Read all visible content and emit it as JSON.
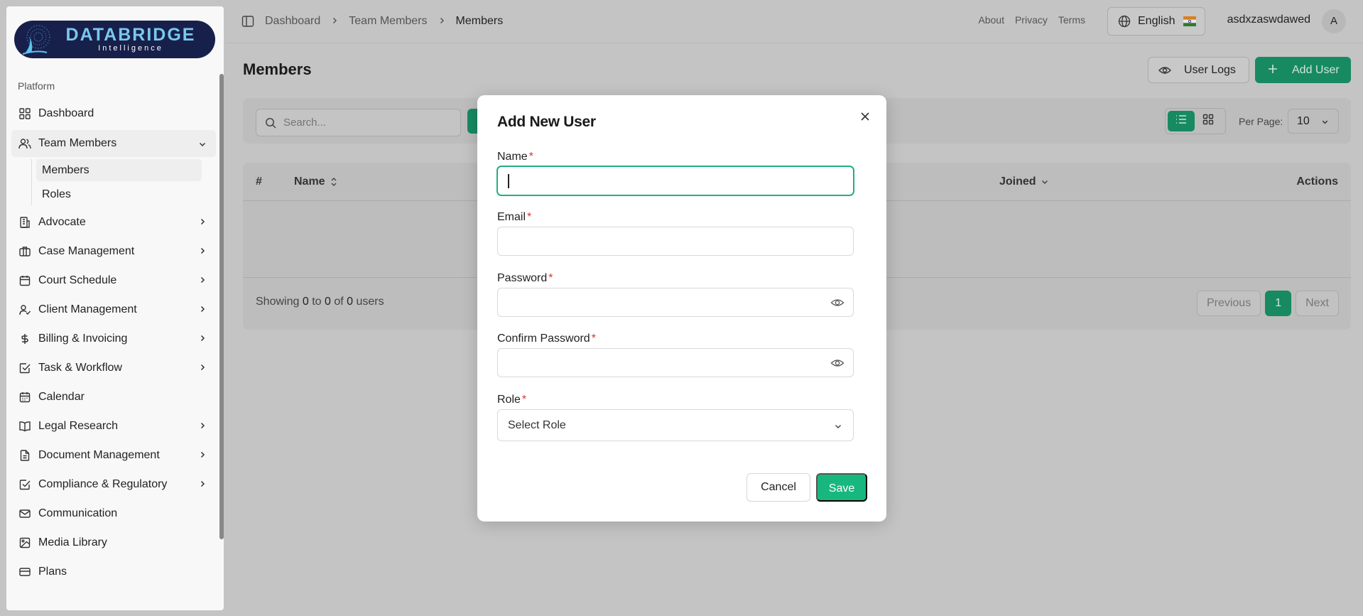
{
  "brand": {
    "name": "DATABRIDGE",
    "tagline": "Intelligence"
  },
  "sidebar": {
    "section_label": "Platform",
    "items": [
      {
        "label": "Dashboard",
        "icon": "dashboard-grid-icon"
      },
      {
        "label": "Team Members",
        "icon": "users-icon",
        "expanded": true,
        "children": [
          {
            "label": "Members",
            "active": true
          },
          {
            "label": "Roles"
          }
        ]
      },
      {
        "label": "Advocate",
        "icon": "building-icon"
      },
      {
        "label": "Case Management",
        "icon": "briefcase-icon"
      },
      {
        "label": "Court Schedule",
        "icon": "calendar-icon"
      },
      {
        "label": "Client Management",
        "icon": "user-check-icon"
      },
      {
        "label": "Billing & Invoicing",
        "icon": "dollar-icon"
      },
      {
        "label": "Task & Workflow",
        "icon": "checkbox-icon"
      },
      {
        "label": "Calendar",
        "icon": "calendar-icon"
      },
      {
        "label": "Legal Research",
        "icon": "book-icon"
      },
      {
        "label": "Document Management",
        "icon": "document-icon"
      },
      {
        "label": "Compliance & Regulatory",
        "icon": "checkbox-icon"
      },
      {
        "label": "Communication",
        "icon": "mail-icon"
      },
      {
        "label": "Media Library",
        "icon": "image-icon"
      },
      {
        "label": "Plans",
        "icon": "credit-card-icon"
      }
    ]
  },
  "header": {
    "breadcrumb": [
      "Dashboard",
      "Team Members",
      "Members"
    ],
    "links": [
      "About",
      "Privacy",
      "Terms"
    ],
    "language": "English",
    "username": "asdxzaswdawed",
    "avatar_initial": "A"
  },
  "page": {
    "title": "Members",
    "user_logs_label": "User Logs",
    "add_user_label": "Add User"
  },
  "filters": {
    "search_placeholder": "Search...",
    "per_page_label": "Per Page:",
    "per_page_value": "10"
  },
  "table": {
    "columns": [
      "#",
      "Name",
      "Joined",
      "Actions"
    ],
    "summary": {
      "prefix": "Showing",
      "from": "0",
      "to_word": "to",
      "to": "0",
      "of_word": "of",
      "total": "0",
      "suffix": "users"
    },
    "pagination": {
      "previous": "Previous",
      "current": "1",
      "next": "Next"
    }
  },
  "modal": {
    "title": "Add New User",
    "fields": {
      "name": {
        "label": "Name",
        "value": ""
      },
      "email": {
        "label": "Email",
        "value": ""
      },
      "password": {
        "label": "Password",
        "value": ""
      },
      "confirm_password": {
        "label": "Confirm Password",
        "value": ""
      },
      "role": {
        "label": "Role",
        "selected": "Select Role"
      }
    },
    "required_marker": "*",
    "cancel_label": "Cancel",
    "save_label": "Save"
  },
  "colors": {
    "accent": "#18b77e",
    "accent_dim": "#178a62",
    "required": "#e03131",
    "overlay": "#c4c4c4"
  }
}
